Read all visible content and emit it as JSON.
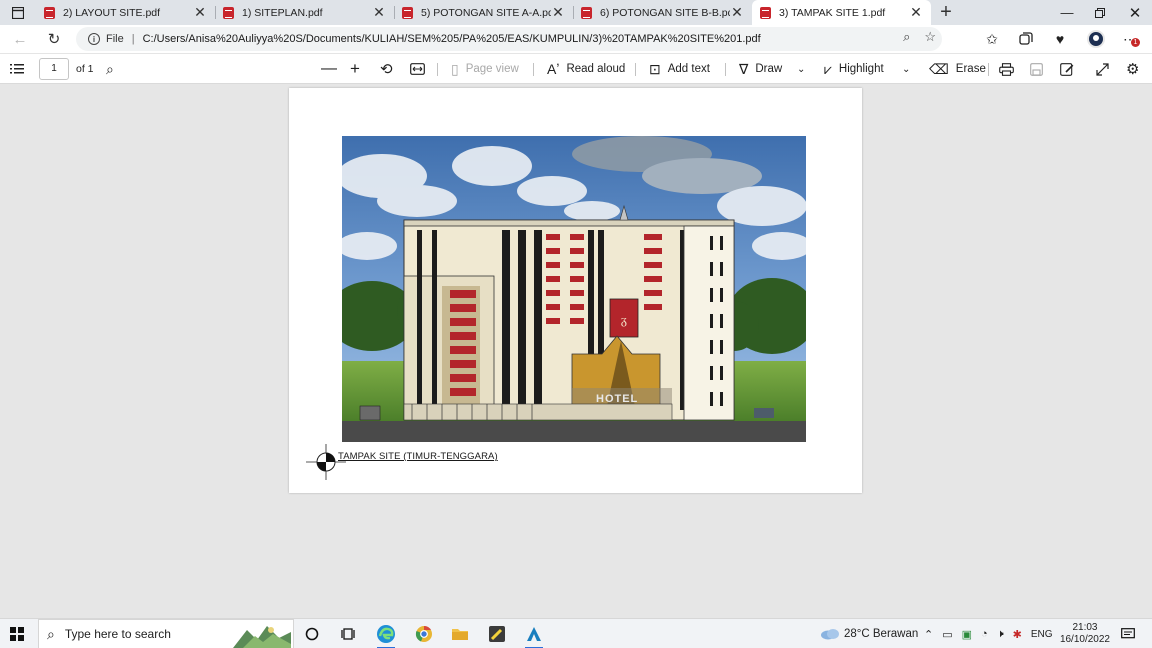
{
  "browser": {
    "tabs": [
      {
        "title": "2) LAYOUT SITE.pdf",
        "active": false
      },
      {
        "title": "1) SITEPLAN.pdf",
        "active": false
      },
      {
        "title": "5) POTONGAN SITE A-A.pdf",
        "active": false
      },
      {
        "title": "6) POTONGAN SITE B-B.pdf",
        "active": false
      },
      {
        "title": "3) TAMPAK SITE 1.pdf",
        "active": true
      }
    ],
    "address": {
      "scheme_label": "File",
      "url": "C:/Users/Anisa%20Auliyya%20S/Documents/KULIAH/SEM%205/PA%205/EAS/KUMPULIN/3)%20TAMPAK%20SITE%201.pdf"
    },
    "notification_count": "1"
  },
  "pdf_toolbar": {
    "page_number": "1",
    "page_total": "of 1",
    "page_view": "Page view",
    "read_aloud": "Read aloud",
    "add_text": "Add text",
    "draw": "Draw",
    "highlight": "Highlight",
    "erase": "Erase"
  },
  "document": {
    "caption": "TAMPAK SITE (TIMUR-TENGGARA)",
    "hotel_sign": "HOTEL"
  },
  "taskbar": {
    "search_placeholder": "Type here to search",
    "weather": "28°C  Berawan",
    "language": "ENG",
    "time": "21:03",
    "date": "16/10/2022"
  },
  "colors": {
    "accent_blue": "#2a6fdb",
    "pdf_red": "#c8252c",
    "facade_red": "#b3252b",
    "sky": "#5f8fc6",
    "grass": "#6c9e3c"
  }
}
